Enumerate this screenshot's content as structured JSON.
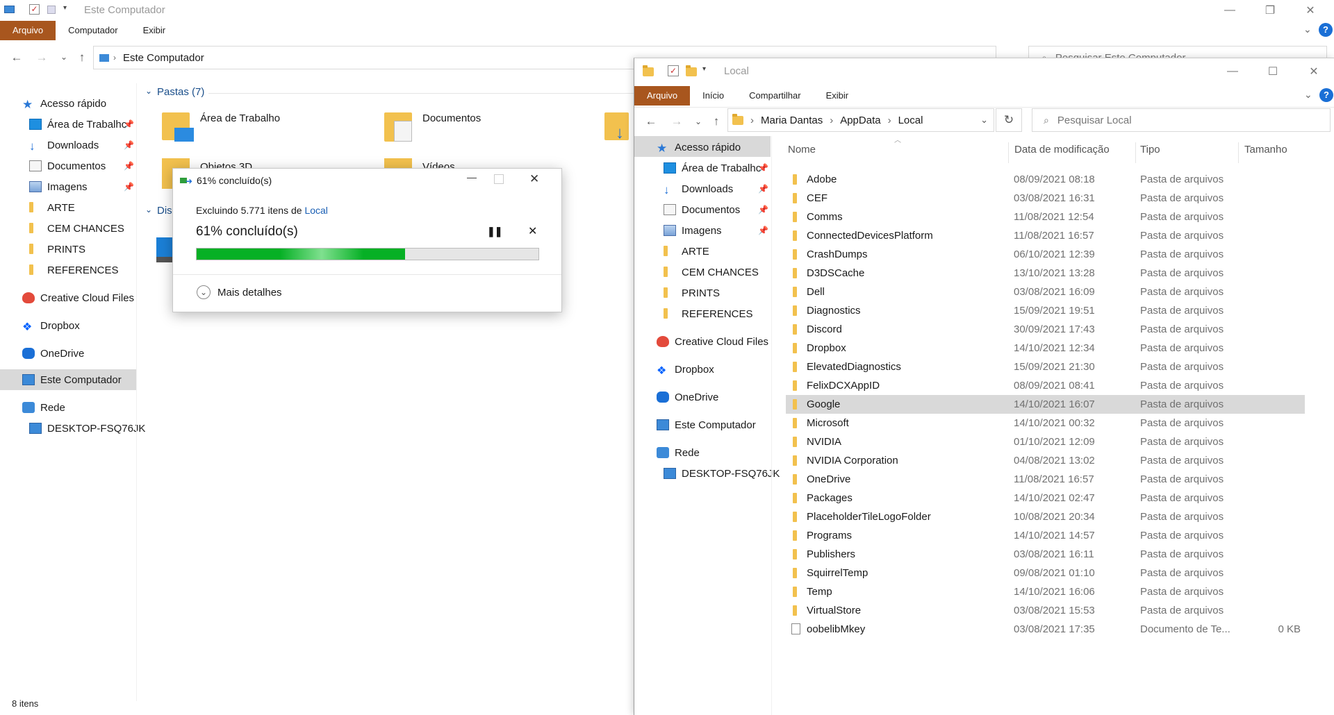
{
  "back_window": {
    "title": "Este Computador",
    "ribbon_tabs": [
      "Arquivo",
      "Computador",
      "Exibir"
    ],
    "address": "Este Computador",
    "search_placeholder": "Pesquisar Este Computador",
    "nav": {
      "quick_access": "Acesso rápido",
      "items": [
        {
          "label": "Área de Trabalhc",
          "icon": "desktop-icon",
          "pinned": true
        },
        {
          "label": "Downloads",
          "icon": "download-icon",
          "pinned": true
        },
        {
          "label": "Documentos",
          "icon": "documents-icon",
          "pinned": true
        },
        {
          "label": "Imagens",
          "icon": "pictures-icon",
          "pinned": true
        },
        {
          "label": "ARTE",
          "icon": "folder-icon",
          "pinned": false
        },
        {
          "label": "CEM CHANCES",
          "icon": "folder-icon",
          "pinned": false
        },
        {
          "label": "PRINTS",
          "icon": "folder-icon",
          "pinned": false
        },
        {
          "label": "REFERENCES",
          "icon": "folder-icon",
          "pinned": false
        }
      ],
      "creative_cloud": "Creative Cloud Files",
      "dropbox": "Dropbox",
      "onedrive": "OneDrive",
      "this_pc": "Este Computador",
      "network": "Rede",
      "network_child": "DESKTOP-FSQ76JK"
    },
    "folders_header": "Pastas (7)",
    "folders": [
      "Área de Trabalho",
      "Documentos",
      "Objetos 3D",
      "Vídeos"
    ],
    "devices_header_fragment": "Disp",
    "status": "8 itens"
  },
  "progress_dialog": {
    "title": "61% concluído(s)",
    "action_text": "Excluindo 5.771 itens de ",
    "action_link": "Local",
    "heading": "61% concluído(s)",
    "progress": 0.61,
    "more_details": "Mais detalhes",
    "progress_color": "#06b025"
  },
  "front_window": {
    "title": "Local",
    "ribbon_tabs": [
      "Arquivo",
      "Início",
      "Compartilhar",
      "Exibir"
    ],
    "breadcrumb": [
      "Maria Dantas",
      "AppData",
      "Local"
    ],
    "search_placeholder": "Pesquisar Local",
    "nav": {
      "quick_access": "Acesso rápido",
      "items": [
        {
          "label": "Área de Trabalhc",
          "icon": "desktop-icon",
          "pinned": true
        },
        {
          "label": "Downloads",
          "icon": "download-icon",
          "pinned": true
        },
        {
          "label": "Documentos",
          "icon": "documents-icon",
          "pinned": true
        },
        {
          "label": "Imagens",
          "icon": "pictures-icon",
          "pinned": true
        },
        {
          "label": "ARTE",
          "icon": "folder-icon",
          "pinned": false
        },
        {
          "label": "CEM CHANCES",
          "icon": "folder-icon",
          "pinned": false
        },
        {
          "label": "PRINTS",
          "icon": "folder-icon",
          "pinned": false
        },
        {
          "label": "REFERENCES",
          "icon": "folder-icon",
          "pinned": false
        }
      ],
      "creative_cloud": "Creative Cloud Files",
      "dropbox": "Dropbox",
      "onedrive": "OneDrive",
      "this_pc": "Este Computador",
      "network": "Rede",
      "network_child": "DESKTOP-FSQ76JK"
    },
    "columns": [
      "Nome",
      "Data de modificação",
      "Tipo",
      "Tamanho"
    ],
    "files": [
      {
        "name": "Adobe",
        "date": "08/09/2021 08:18",
        "type": "Pasta de arquivos",
        "size": "",
        "icon": "folder-icon"
      },
      {
        "name": "CEF",
        "date": "03/08/2021 16:31",
        "type": "Pasta de arquivos",
        "size": "",
        "icon": "folder-icon"
      },
      {
        "name": "Comms",
        "date": "11/08/2021 12:54",
        "type": "Pasta de arquivos",
        "size": "",
        "icon": "folder-icon"
      },
      {
        "name": "ConnectedDevicesPlatform",
        "date": "11/08/2021 16:57",
        "type": "Pasta de arquivos",
        "size": "",
        "icon": "folder-icon"
      },
      {
        "name": "CrashDumps",
        "date": "06/10/2021 12:39",
        "type": "Pasta de arquivos",
        "size": "",
        "icon": "folder-icon"
      },
      {
        "name": "D3DSCache",
        "date": "13/10/2021 13:28",
        "type": "Pasta de arquivos",
        "size": "",
        "icon": "folder-icon"
      },
      {
        "name": "Dell",
        "date": "03/08/2021 16:09",
        "type": "Pasta de arquivos",
        "size": "",
        "icon": "folder-icon"
      },
      {
        "name": "Diagnostics",
        "date": "15/09/2021 19:51",
        "type": "Pasta de arquivos",
        "size": "",
        "icon": "folder-icon"
      },
      {
        "name": "Discord",
        "date": "30/09/2021 17:43",
        "type": "Pasta de arquivos",
        "size": "",
        "icon": "folder-icon"
      },
      {
        "name": "Dropbox",
        "date": "14/10/2021 12:34",
        "type": "Pasta de arquivos",
        "size": "",
        "icon": "folder-icon"
      },
      {
        "name": "ElevatedDiagnostics",
        "date": "15/09/2021 21:30",
        "type": "Pasta de arquivos",
        "size": "",
        "icon": "folder-icon"
      },
      {
        "name": "FelixDCXAppID",
        "date": "08/09/2021 08:41",
        "type": "Pasta de arquivos",
        "size": "",
        "icon": "folder-icon"
      },
      {
        "name": "Google",
        "date": "14/10/2021 16:07",
        "type": "Pasta de arquivos",
        "size": "",
        "icon": "folder-icon",
        "selected": true
      },
      {
        "name": "Microsoft",
        "date": "14/10/2021 00:32",
        "type": "Pasta de arquivos",
        "size": "",
        "icon": "folder-icon"
      },
      {
        "name": "NVIDIA",
        "date": "01/10/2021 12:09",
        "type": "Pasta de arquivos",
        "size": "",
        "icon": "folder-icon"
      },
      {
        "name": "NVIDIA Corporation",
        "date": "04/08/2021 13:02",
        "type": "Pasta de arquivos",
        "size": "",
        "icon": "folder-icon"
      },
      {
        "name": "OneDrive",
        "date": "11/08/2021 16:57",
        "type": "Pasta de arquivos",
        "size": "",
        "icon": "folder-icon"
      },
      {
        "name": "Packages",
        "date": "14/10/2021 02:47",
        "type": "Pasta de arquivos",
        "size": "",
        "icon": "folder-icon"
      },
      {
        "name": "PlaceholderTileLogoFolder",
        "date": "10/08/2021 20:34",
        "type": "Pasta de arquivos",
        "size": "",
        "icon": "folder-icon"
      },
      {
        "name": "Programs",
        "date": "14/10/2021 14:57",
        "type": "Pasta de arquivos",
        "size": "",
        "icon": "folder-icon"
      },
      {
        "name": "Publishers",
        "date": "03/08/2021 16:11",
        "type": "Pasta de arquivos",
        "size": "",
        "icon": "folder-icon"
      },
      {
        "name": "SquirrelTemp",
        "date": "09/08/2021 01:10",
        "type": "Pasta de arquivos",
        "size": "",
        "icon": "folder-icon"
      },
      {
        "name": "Temp",
        "date": "14/10/2021 16:06",
        "type": "Pasta de arquivos",
        "size": "",
        "icon": "folder-icon"
      },
      {
        "name": "VirtualStore",
        "date": "03/08/2021 15:53",
        "type": "Pasta de arquivos",
        "size": "",
        "icon": "folder-icon"
      },
      {
        "name": "oobelibMkey",
        "date": "03/08/2021 17:35",
        "type": "Documento de Te...",
        "size": "0 KB",
        "icon": "text-file-icon"
      }
    ]
  }
}
